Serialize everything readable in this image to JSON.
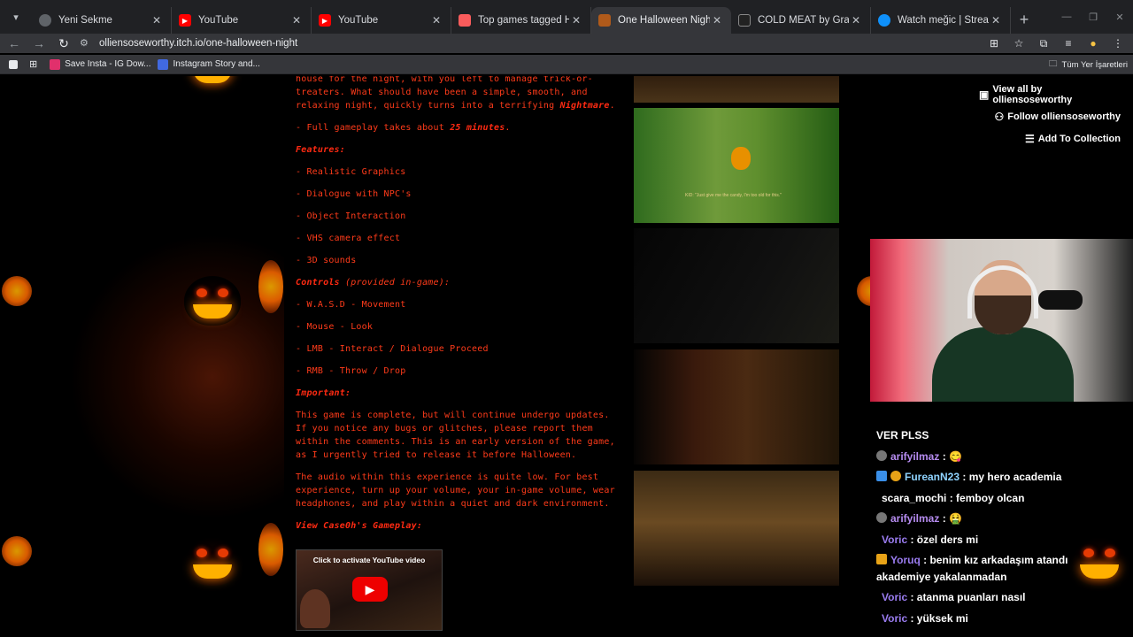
{
  "tabs": [
    {
      "title": "Yeni Sekme",
      "color": "#5f6368"
    },
    {
      "title": "YouTube",
      "color": "#ff0000"
    },
    {
      "title": "YouTube",
      "color": "#ff0000"
    },
    {
      "title": "Top games tagged Horror - itc",
      "color": "#fa5c5c"
    },
    {
      "title": "One Halloween Night by ollien",
      "color": "#b05a1a",
      "active": true
    },
    {
      "title": "COLD MEAT by GravityRaccoon",
      "color": "#222222"
    },
    {
      "title": "Watch meğic | Streamable",
      "color": "#0f90fa"
    }
  ],
  "address": {
    "url": "olliensoseworthy.itch.io/one-halloween-night"
  },
  "bookmarks": [
    {
      "label": "Save Insta - IG Dow..."
    },
    {
      "label": "Instagram Story and..."
    }
  ],
  "bookmarks_all": "Tüm Yer İşaretleri",
  "description": {
    "intro": "house for the night, with you left to manage trick-or-treaters. What should have been a simple, smooth, and relaxing night, quickly turns into a terrifying",
    "intro_hl": "Nightmare",
    "gameplay_prefix": "- Full gameplay takes about",
    "gameplay_hl": "25 minutes",
    "features_heading": "Features:",
    "features": [
      "- Realistic Graphics",
      "- Dialogue with NPC's",
      "- Object Interaction",
      "- VHS camera effect",
      "- 3D sounds"
    ],
    "controls_heading": "Controls",
    "controls_note": "(provided in-game):",
    "controls": [
      "- W.A.S.D - Movement",
      "- Mouse - Look",
      "- LMB - Interact / Dialogue Proceed",
      "- RMB - Throw / Drop"
    ],
    "important_heading": "Important:",
    "important_text": "This game is complete, but will continue undergo updates. If you notice any bugs or glitches, please report them within the comments.  This is an early version of the game, as I urgently tried to release it before Halloween.",
    "audio_text": "The audio within this experience is quite low. For best experience, turn up your volume, your in-game volume, wear headphones, and play within a quiet and dark environment.",
    "view_heading": "View Case0h's Gameplay:"
  },
  "youtube": {
    "caption": "Click to activate YouTube video"
  },
  "actions": {
    "view_all": "View all by olliensoseworthy",
    "follow": "Follow olliensoseworthy",
    "collection": "Add To Collection"
  },
  "screenshot_subtitle": "KID: \"Just give me the candy, I'm too old for this.\"",
  "chat": {
    "partial": "VER PLSS",
    "messages": [
      {
        "user": "arifyilmaz",
        "text": " : 😋"
      },
      {
        "user": "FureanN23",
        "text": " : my hero academia"
      },
      {
        "user": "scara_mochi",
        "text": " : femboy olcan"
      },
      {
        "user": "arifyilmaz",
        "text": " : 🤮"
      },
      {
        "user": "Voric",
        "text": " : özel ders mi"
      },
      {
        "user": "Yoruq",
        "text": " : benim kız arkadaşım atandı akademiye yakalanmadan"
      },
      {
        "user": "Voric",
        "text": " : atanma puanları nasıl"
      },
      {
        "user": "Voric",
        "text": " : yüksek mi"
      }
    ]
  }
}
